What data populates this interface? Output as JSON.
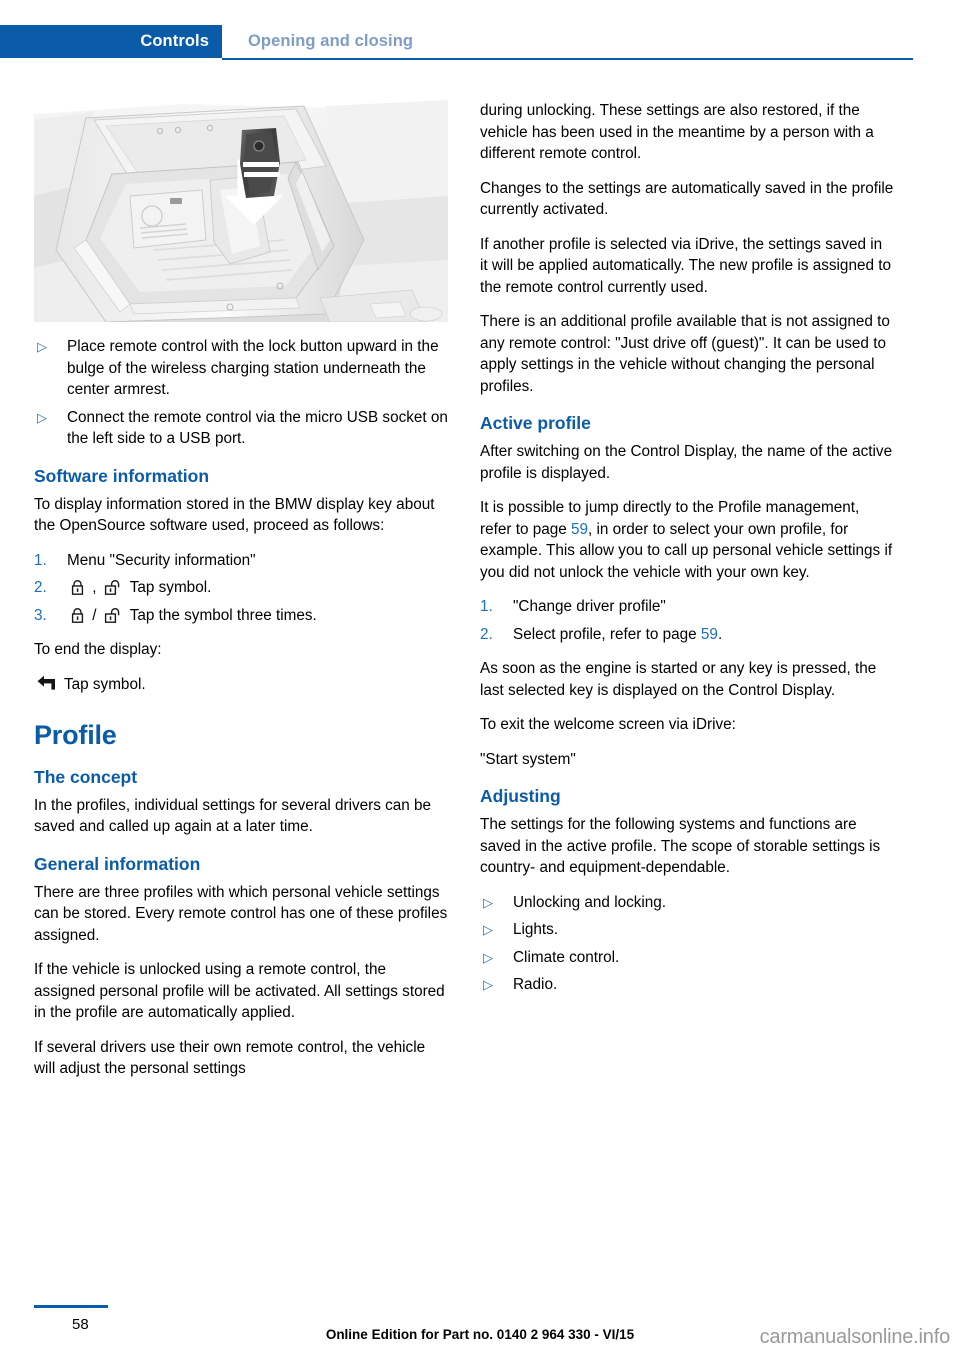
{
  "header": {
    "chapter_tab": "Controls",
    "section_title": "Opening and closing"
  },
  "figure": {
    "alt": "center-console-armrest-with-remote-control-illustration",
    "caption": ""
  },
  "left_column": {
    "intro_bullets": [
      "Place remote control with the lock button upward in the bulge of the wireless charging station underneath the center armrest.",
      "Connect the remote control via the micro USB socket on the left side to a USB port."
    ],
    "software_information": {
      "heading": "Software information",
      "intro": "To display information stored in the BMW display key about the OpenSource software used, proceed as follows:",
      "steps": [
        {
          "num": "1.",
          "text": "Menu \"Security information\"",
          "symbols": []
        },
        {
          "num": "2.",
          "pre": "",
          "text": "Tap symbol.",
          "symbols": [
            "lock-closed-icon",
            "comma",
            "lock-open-icon"
          ]
        },
        {
          "num": "3.",
          "pre": "",
          "text": "Tap the symbol three times.",
          "symbols": [
            "lock-closed-icon",
            "slash",
            "lock-open-icon"
          ]
        }
      ],
      "end_intro": "To end the display:",
      "end_step": "Tap symbol.",
      "end_symbol": "back-arrow-icon"
    },
    "profile": {
      "heading": "Profile",
      "the_concept": {
        "heading": "The concept",
        "text": "In the profiles, individual settings for several drivers can be saved and called up again at a later time."
      },
      "general_information": {
        "heading": "General information",
        "paragraphs": [
          "There are three profiles with which personal vehicle settings can be stored. Every remote control has one of these profiles assigned.",
          "If the vehicle is unlocked using a remote control, the assigned personal profile will be activated. All settings stored in the profile are automatically applied.",
          "If several drivers use their own remote control, the vehicle will adjust the personal settings"
        ]
      }
    }
  },
  "right_column": {
    "continued_paragraphs": [
      "during unlocking. These settings are also restored, if the vehicle has been used in the meantime by a person with a different remote control.",
      "Changes to the settings are automatically saved in the profile currently activated.",
      "If another profile is selected via iDrive, the settings saved in it will be applied automatically. The new profile is assigned to the remote control currently used.",
      "There is an additional profile available that is not assigned to any remote control: \"Just drive off (guest)\". It can be used to apply settings in the vehicle without changing the personal profiles."
    ],
    "active_profile": {
      "heading": "Active profile",
      "paragraph_1": "After switching on the Control Display, the name of the active profile is displayed.",
      "paragraph_2_part1": "It is possible to jump directly to the Profile management, refer to page ",
      "paragraph_2_xref": "59",
      "paragraph_2_part2": ", in order to select your own profile, for example. This allow you to call up personal vehicle settings if you did not unlock the vehicle with your own key.",
      "steps": [
        {
          "num": "1.",
          "text": "\"Change driver profile\""
        },
        {
          "num": "2.",
          "text_part1": "Select profile, refer to page ",
          "xref": "59",
          "text_part2": "."
        }
      ],
      "paragraph_3": "As soon as the engine is started or any key is pressed, the last selected key is displayed on the Control Display.",
      "paragraph_4": "To exit the welcome screen via iDrive:",
      "paragraph_5": "\"Start system\""
    },
    "adjusting": {
      "heading": "Adjusting",
      "paragraph": "The settings for the following systems and functions are saved in the active profile. The scope of storable settings is country- and equipment-dependable.",
      "bullets": [
        "Unlocking and locking.",
        "Lights.",
        "Climate control.",
        "Radio."
      ]
    }
  },
  "footer": {
    "page_number": "58",
    "edition": "Online Edition for Part no. 0140 2 964 330 - VI/15",
    "watermark": "carmanualsonline.info"
  },
  "colors": {
    "brand_blue": "#0a5ba8",
    "link_blue": "#1b6ec2",
    "muted_blue": "#7f9dc4",
    "bullet_blue": "#2f6fb5"
  }
}
